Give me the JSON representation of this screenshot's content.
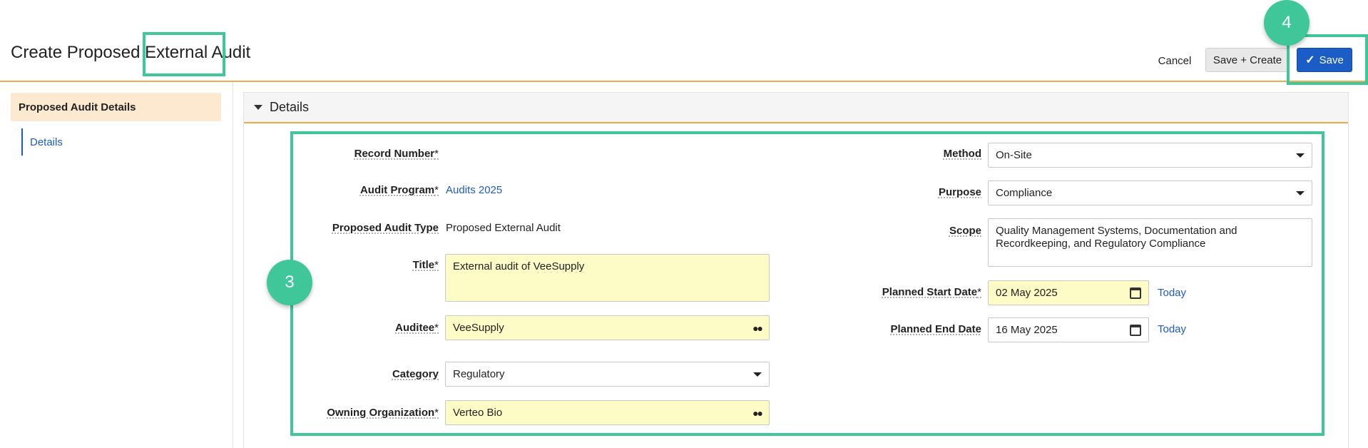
{
  "header": {
    "title": "Create Proposed External Audit",
    "cancel_label": "Cancel",
    "save_create_label": "Save + Create",
    "save_label": "Save",
    "save_icon": "check-icon"
  },
  "sidebar": {
    "section_label": "Proposed Audit Details",
    "items": [
      {
        "label": "Details"
      }
    ]
  },
  "panel": {
    "title": "Details"
  },
  "form": {
    "record_number": {
      "label": "Record Number",
      "required": "*",
      "value": ""
    },
    "audit_program": {
      "label": "Audit Program",
      "required": "*",
      "value": "Audits 2025"
    },
    "proposed_audit_type": {
      "label": "Proposed Audit Type",
      "value": "Proposed External Audit"
    },
    "title": {
      "label": "Title",
      "required": "*",
      "value_prefix": "External audit of ",
      "value_misspelled": "VeeSupply"
    },
    "auditee": {
      "label": "Auditee",
      "required": "*",
      "value": "VeeSupply"
    },
    "category": {
      "label": "Category",
      "value": "Regulatory"
    },
    "owning_organization": {
      "label": "Owning Organization",
      "required": "*",
      "value": "Verteo Bio"
    },
    "method": {
      "label": "Method",
      "value": "On-Site"
    },
    "purpose": {
      "label": "Purpose",
      "value": "Compliance"
    },
    "scope": {
      "label": "Scope",
      "value": "Quality Management Systems, Documentation and Recordkeeping, and Regulatory Compliance"
    },
    "planned_start_date": {
      "label": "Planned Start Date",
      "required": "*",
      "value": "02 May 2025",
      "today_label": "Today"
    },
    "planned_end_date": {
      "label": "Planned End Date",
      "value": "16 May 2025",
      "today_label": "Today"
    }
  },
  "annotations": {
    "badge_3": "3",
    "badge_4": "4",
    "accent_color": "#3fc79a"
  },
  "colors": {
    "primary": "#1b5cc7",
    "divider": "#f2a84f",
    "required_field_bg": "#fdfbc6",
    "nav_section_bg": "#fde9cf"
  }
}
